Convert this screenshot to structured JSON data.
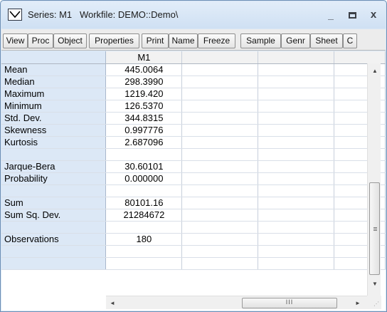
{
  "window": {
    "title": "Series: M1   Workfile: DEMO::Demo\\",
    "min_glyph": "_",
    "close_glyph": "x"
  },
  "toolbar": [
    "View",
    "Proc",
    "Object",
    "Properties",
    "Print",
    "Name",
    "Freeze",
    "Sample",
    "Genr",
    "Sheet",
    "C"
  ],
  "grid": {
    "column_header": "M1",
    "rows": [
      {
        "label": "Mean",
        "value": "445.0064"
      },
      {
        "label": "Median",
        "value": "298.3990"
      },
      {
        "label": "Maximum",
        "value": "1219.420"
      },
      {
        "label": "Minimum",
        "value": "126.5370"
      },
      {
        "label": "Std. Dev.",
        "value": "344.8315"
      },
      {
        "label": "Skewness",
        "value": "0.997776"
      },
      {
        "label": "Kurtosis",
        "value": "2.687096"
      },
      {
        "label": "",
        "value": ""
      },
      {
        "label": "Jarque-Bera",
        "value": "30.60101"
      },
      {
        "label": "Probability",
        "value": "0.000000"
      },
      {
        "label": "",
        "value": ""
      },
      {
        "label": "Sum",
        "value": "80101.16"
      },
      {
        "label": "Sum Sq. Dev.",
        "value": "21284672"
      },
      {
        "label": "",
        "value": ""
      },
      {
        "label": "Observations",
        "value": "180"
      },
      {
        "label": "",
        "value": ""
      },
      {
        "label": "",
        "value": ""
      }
    ]
  },
  "scrollbars": {
    "up_glyph": "▲",
    "down_glyph": "▼",
    "left_glyph": "◄",
    "right_glyph": "►",
    "h_thumb_glyph": "III",
    "v_thumb_glyph": "≡"
  }
}
